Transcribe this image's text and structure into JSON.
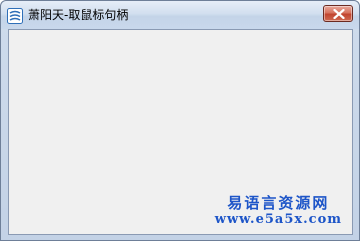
{
  "window": {
    "title": "萧阳天-取鼠标句柄",
    "app_icon": "app-icon",
    "close_icon": "close-icon"
  },
  "watermark": {
    "line1": "易语言资源网",
    "line2": "www.e5a5x.com",
    "color": "#1d55c8"
  },
  "colors": {
    "client_background": "#f0f0f0",
    "close_button": "#c1452f"
  }
}
